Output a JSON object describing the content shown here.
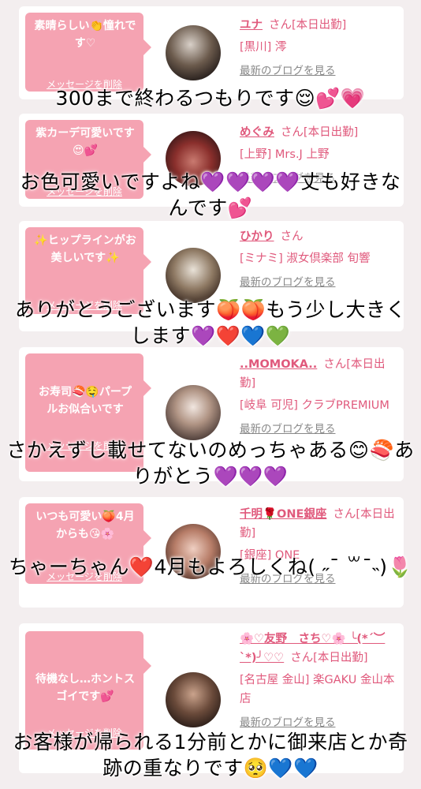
{
  "cards": [
    {
      "message": "素晴らしい👏憧れです♡",
      "delete_label": "メッセージを削除",
      "name": "ユナ",
      "san": "さん[本日出勤]",
      "shop": "[黒川] 澪",
      "blog_label": "最新のブログを見る"
    },
    {
      "message": "紫カーデ可愛いです😍💕",
      "delete_label": "メッセージを削除",
      "name": "めぐみ",
      "san": "さん[本日出勤]",
      "shop": "[上野] Mrs.J 上野",
      "blog_label": "最新のブログを見る"
    },
    {
      "message": "✨ヒップラインがお美しいです✨",
      "delete_label": "メッセージを削除",
      "name": "ひかり",
      "san": "さん",
      "shop": "[ミナミ] 淑女倶楽部 旬響",
      "blog_label": "最新のブログを見る"
    },
    {
      "message": "お寿司🍣🤤パープルお似合いです",
      "delete_label": "メッセージを削除",
      "name": "..MOMOKA..",
      "san": "さん[本日出勤]",
      "shop": "[岐阜 可児] クラブPREMIUM",
      "blog_label": "最新のブログを見る"
    },
    {
      "message": "いつも可愛い🍑4月からも😘🌸",
      "delete_label": "メッセージを削除",
      "name": "千明🌹ONE銀座",
      "san": "さん[本日出勤]",
      "shop": "[銀座] ONE",
      "blog_label": "最新のブログを見る"
    },
    {
      "message": "待機なし…ホントスゴイです💕",
      "delete_label": "メッセージを削除",
      "name": "🌸♡友野　さち♡🌸 ╰(*´︶`*)╯♡♡",
      "san": "さん[本日出勤]",
      "shop": "[名古屋 金山] 楽GAKU 金山本店",
      "blog_label": "最新のブログを見る"
    }
  ],
  "overlays": [
    "300まで終わるつもりです😌💕💗",
    "お色可愛いですよね💜💜💜💜丈も好きなんです💕",
    "ありがとうございます🍑🍑もう少し大きくします💜❤️💙💚",
    "さかえずし載せてないのめっちゃある😊🍣ありがとう💜💜💜",
    "ちゃーちゃん❤️4月もよろしくね( ˶¯ ꒳¯˵)🌷",
    "お客様が帰られる1分前とかに御来店とか奇跡の重なりです🥺💙💙"
  ],
  "colors": {
    "bubble": "#f5a3b2",
    "accent": "#e0597c",
    "background": "#f3eeef"
  }
}
